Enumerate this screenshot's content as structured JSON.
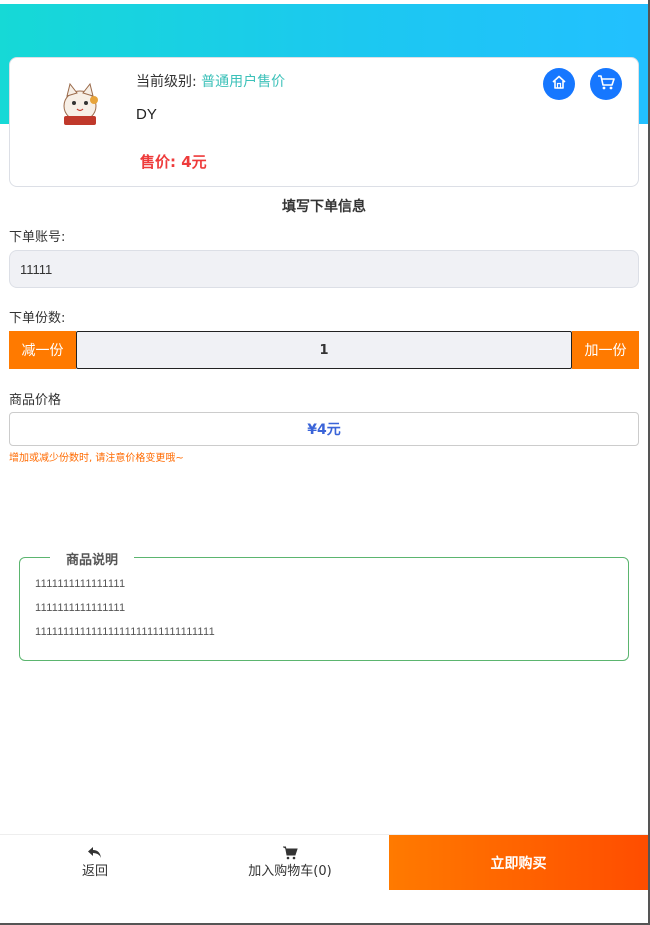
{
  "product": {
    "level_label": "当前级别:",
    "level_value": "普通用户售价",
    "name": "DY",
    "price_text": "售价: 4元"
  },
  "icons": {
    "home": "home-icon",
    "cart": "cart-icon",
    "back": "back-arrow-icon"
  },
  "form": {
    "title": "填写下单信息",
    "account_label": "下单账号:",
    "account_value": "11111",
    "quantity_label": "下单份数:",
    "decrease_label": "减一份",
    "quantity_value": "1",
    "increase_label": "加一份",
    "price_label": "商品价格",
    "price_value": "¥4元",
    "price_note": "增加或减少份数时, 请注意价格变更哦~"
  },
  "description": {
    "title": "商品说明",
    "lines": [
      "1111111111111111",
      "1111111111111111",
      "11111111111111111111111111111111"
    ]
  },
  "bottom": {
    "back_label": "返回",
    "cart_label": "加入购物车(0)",
    "buy_label": "立即购买"
  },
  "colors": {
    "accent_blue": "#1677ff",
    "accent_orange": "#ff7a00",
    "price_red": "#ee3b3b",
    "level_teal": "#3cc1b9",
    "desc_border_green": "#5bb56f"
  }
}
